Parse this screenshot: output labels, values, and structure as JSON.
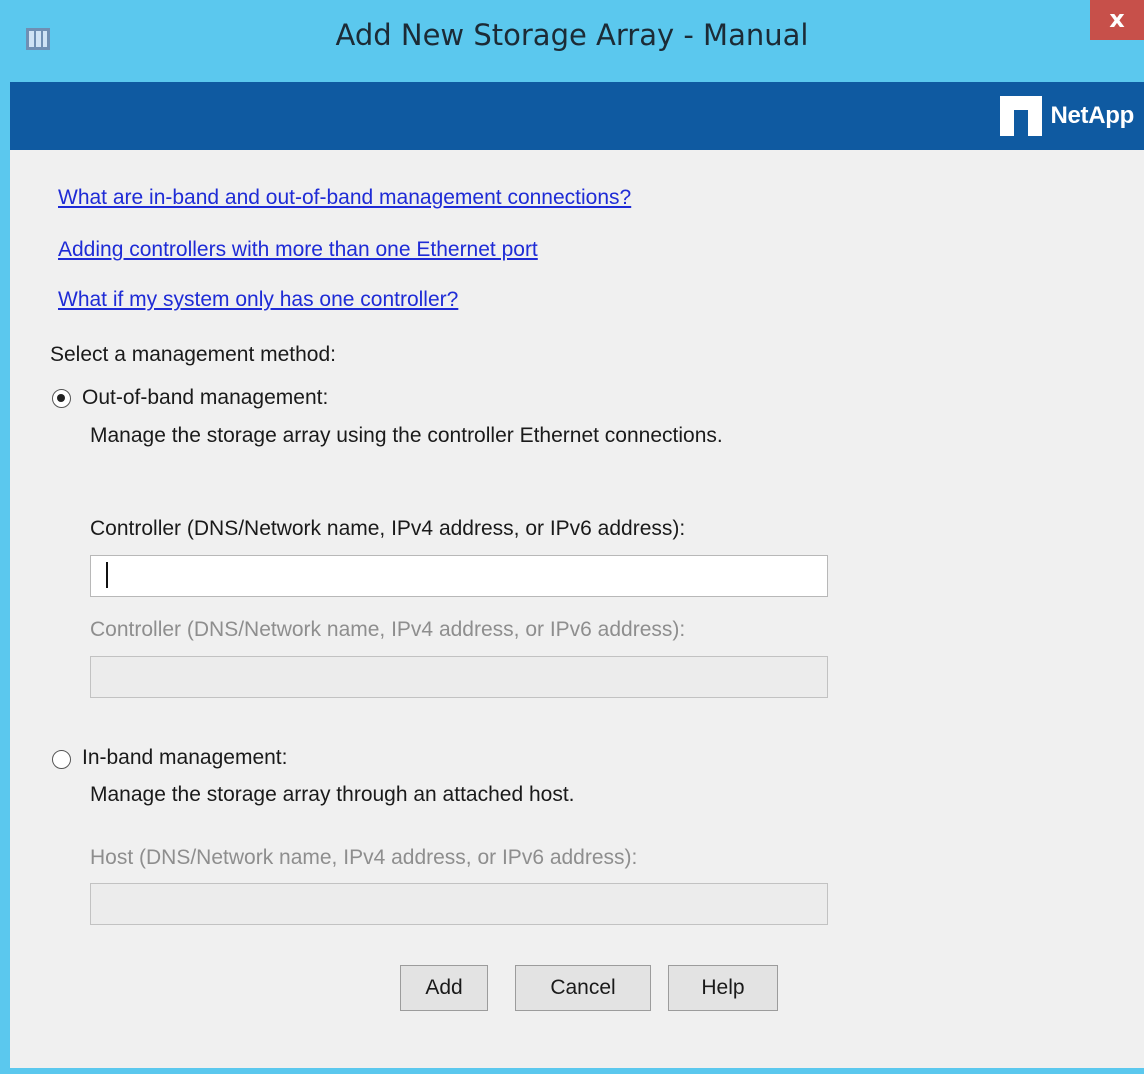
{
  "window": {
    "title": "Add New Storage Array - Manual",
    "close_label": "x",
    "icon": "storage-array-app-icon"
  },
  "banner": {
    "logo_text": "NetApp",
    "logo_icon": "netapp-logo-mark"
  },
  "links": [
    "What are in-band and out-of-band management connections?",
    "Adding controllers with more than one Ethernet port",
    "What if my system only has one controller?"
  ],
  "management": {
    "prompt": "Select a management method:",
    "out_of_band": {
      "label": "Out-of-band management:",
      "description": "Manage the storage array using the controller Ethernet connections.",
      "selected": true,
      "controller1_label": "Controller (DNS/Network name, IPv4 address, or IPv6 address):",
      "controller1_value": "",
      "controller2_label": "Controller (DNS/Network name, IPv4 address, or IPv6 address):",
      "controller2_value": ""
    },
    "in_band": {
      "label": "In-band management:",
      "description": "Manage the storage array through an attached host.",
      "selected": false,
      "host_label": "Host (DNS/Network name, IPv4 address, or IPv6 address):",
      "host_value": ""
    }
  },
  "buttons": {
    "add": "Add",
    "cancel": "Cancel",
    "help": "Help"
  },
  "colors": {
    "titlebar": "#5bc8ee",
    "banner": "#0f5aa1",
    "close": "#c7504a",
    "link": "#1e2bd6",
    "dialog_bg": "#f0f0f0"
  }
}
